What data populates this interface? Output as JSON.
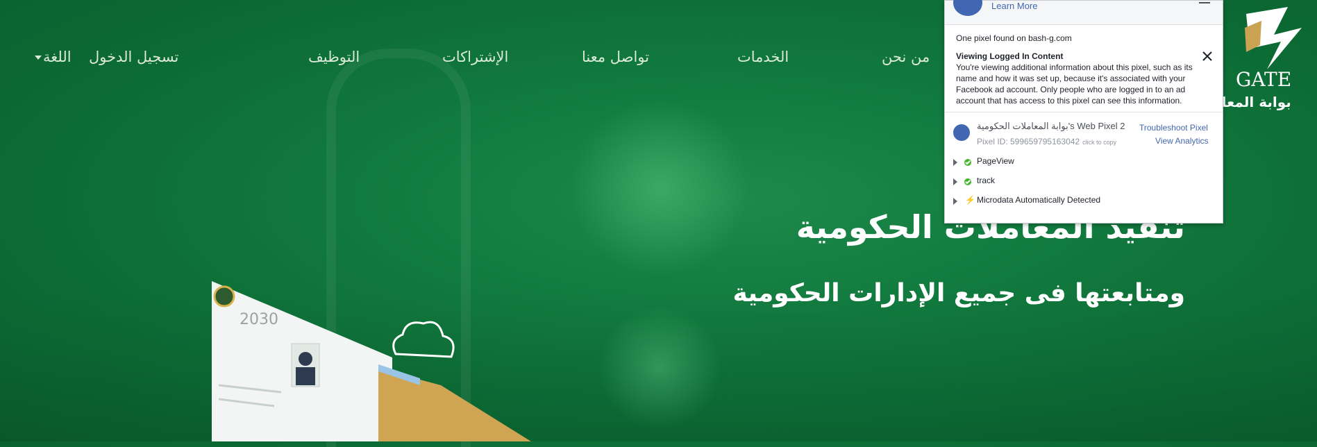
{
  "colors": {
    "primary_green": "#117a3e",
    "fb_blue": "#4267b2",
    "success": "#42b72a"
  },
  "nav": {
    "items": [
      "من نحن",
      "الخدمات",
      "تواصل معنا",
      "الإشتراكات",
      "التوظيف"
    ],
    "login": "تسجيل الدخول",
    "language": "اللغة"
  },
  "logo": {
    "en": "GATE",
    "ar": "بوابة المعام"
  },
  "hero": {
    "title": "تنفيذ المعاملات الحكومية",
    "subtitle": "ومتابعتها فى جميع الإدارات الحكومية"
  },
  "illustration": {
    "badge": "2030"
  },
  "pixel_helper": {
    "learn_more": "Learn More",
    "found_text": "One pixel found on bash-g.com",
    "viewing_title": "Viewing Logged In Content",
    "viewing_text": "You're viewing additional information about this pixel, such as its name and how it was set up, because it's associated with your Facebook ad account. Only people who are logged in to an ad account that has access to this pixel can see this information.",
    "pixel_name": "بوابة المعاملات الحكومية's Web Pixel 2",
    "pixel_id": "Pixel ID: 599659795163042",
    "click_to_copy": "click to copy",
    "troubleshoot": "Troubleshoot Pixel",
    "view_analytics": "View Analytics",
    "events": [
      "PageView",
      "track",
      "Microdata Automatically Detected"
    ]
  }
}
